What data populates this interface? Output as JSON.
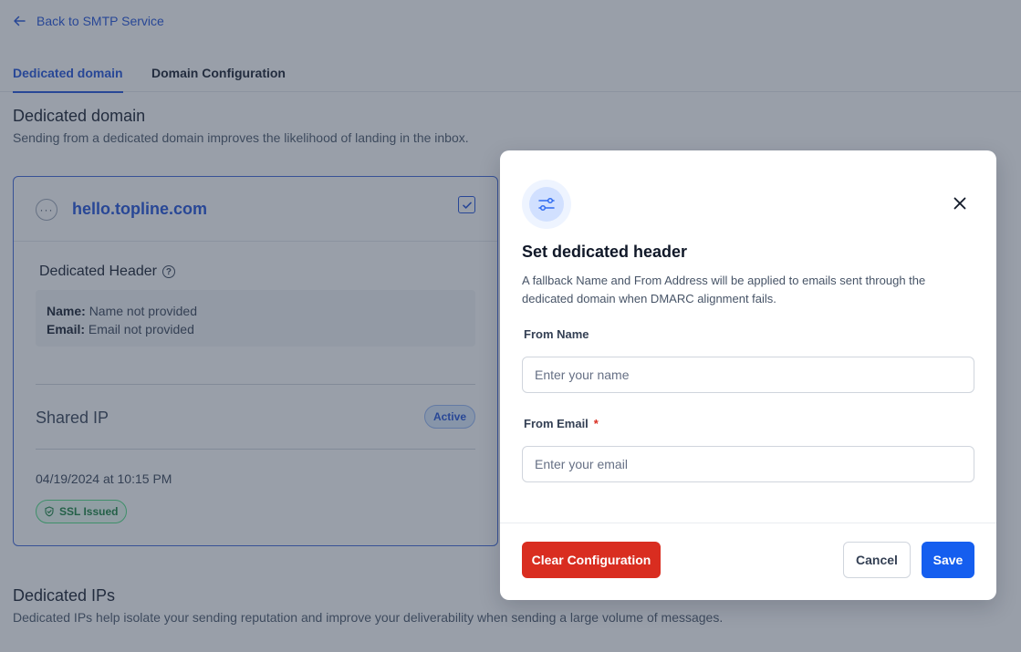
{
  "nav": {
    "back_label": "Back to SMTP Service"
  },
  "tabs": [
    {
      "label": "Dedicated domain",
      "active": true
    },
    {
      "label": "Domain Configuration",
      "active": false
    }
  ],
  "dedicated_domain": {
    "title": "Dedicated domain",
    "description": "Sending from a dedicated domain improves the likelihood of landing in the inbox.",
    "card": {
      "domain": "hello.topline.com",
      "header_title": "Dedicated Header",
      "name_label": "Name:",
      "name_value": "Name not provided",
      "email_label": "Email:",
      "email_value": "Email not provided",
      "ip_type": "Shared IP",
      "ip_status": "Active",
      "timestamp": "04/19/2024 at 10:15 PM",
      "ssl_status": "SSL Issued"
    }
  },
  "dedicated_ips": {
    "title": "Dedicated IPs",
    "description": "Dedicated IPs help isolate your sending reputation and improve your deliverability when sending a large volume of messages."
  },
  "modal": {
    "title": "Set dedicated header",
    "description": "A fallback Name and From Address will be applied to emails sent through the dedicated domain when DMARC alignment fails.",
    "from_name_label": "From Name",
    "from_name_placeholder": "Enter your name",
    "from_name_value": "",
    "from_email_label": "From Email",
    "from_email_required": "*",
    "from_email_placeholder": "Enter your email",
    "from_email_value": "",
    "clear_label": "Clear Configuration",
    "cancel_label": "Cancel",
    "save_label": "Save"
  },
  "colors": {
    "primary": "#155eef",
    "link": "#1d4ed8",
    "danger": "#d92d20",
    "success": "#15803d"
  },
  "icons": {
    "back": "arrow-left-icon",
    "more": "more-horizontal-icon",
    "check": "checkbox-checked-icon",
    "help": "help-circle-icon",
    "ssl": "shield-check-icon",
    "modal": "sliders-icon",
    "close": "close-icon"
  }
}
